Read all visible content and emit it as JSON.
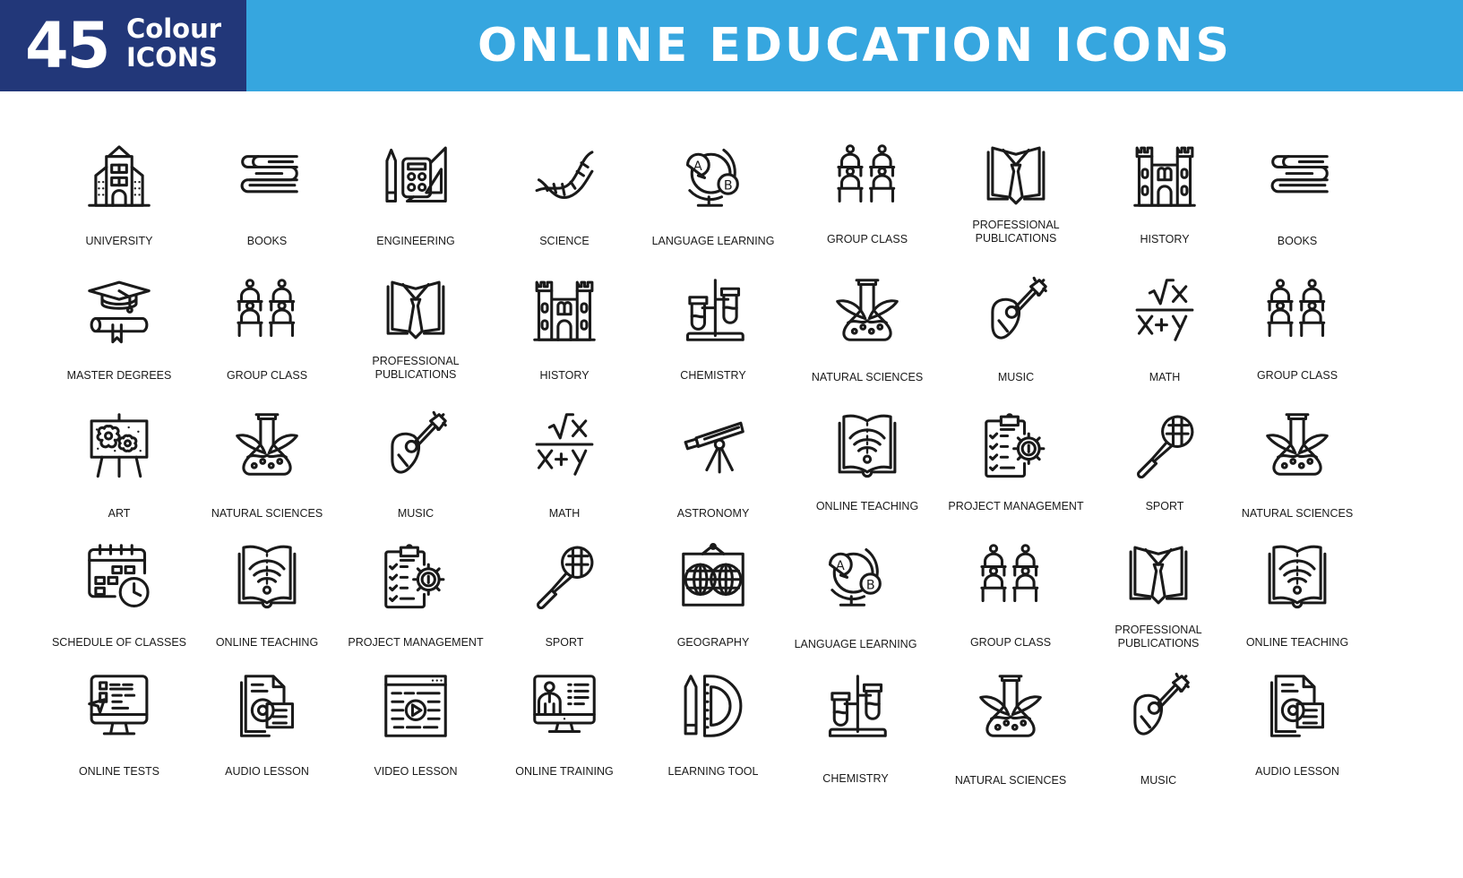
{
  "header": {
    "count": "45",
    "count_word1": "Colour",
    "count_word2": "ICONS",
    "title": "ONLINE EDUCATION ICONS",
    "colors": {
      "badge": "#223779",
      "banner": "#36a6df",
      "text": "#ffffff",
      "icon_stroke": "#1a1a1a"
    }
  },
  "rows": [
    [
      {
        "icon": "university-icon",
        "label": "UNIVERSITY"
      },
      {
        "icon": "books-icon",
        "label": "BOOKS"
      },
      {
        "icon": "engineering-icon",
        "label": "ENGINEERING"
      },
      {
        "icon": "dna-icon",
        "label": "SCIENCE"
      },
      {
        "icon": "language-globe-icon",
        "label": "LANGUAGE LEARNING"
      },
      {
        "icon": "group-class-icon",
        "label": "GROUP CLASS"
      },
      {
        "icon": "book-tie-icon",
        "label": "PROFESSIONAL PUBLICATIONS"
      },
      {
        "icon": "castle-icon",
        "label": "HISTORY"
      },
      {
        "icon": "books-icon",
        "label": "BOOKS"
      }
    ],
    [
      {
        "icon": "graduation-diploma-icon",
        "label": "MASTER DEGREES"
      },
      {
        "icon": "group-class-icon",
        "label": "GROUP CLASS"
      },
      {
        "icon": "book-tie-icon",
        "label": "PROFESSIONAL PUBLICATIONS"
      },
      {
        "icon": "castle-icon",
        "label": "HISTORY"
      },
      {
        "icon": "test-tubes-icon",
        "label": "CHEMISTRY"
      },
      {
        "icon": "flask-leaves-icon",
        "label": "NATURAL SCIENCES"
      },
      {
        "icon": "mandolin-icon",
        "label": "MUSIC"
      },
      {
        "icon": "math-formula-icon",
        "label": "MATH"
      },
      {
        "icon": "group-class-icon",
        "label": "GROUP CLASS"
      }
    ],
    [
      {
        "icon": "easel-painting-icon",
        "label": "ART"
      },
      {
        "icon": "flask-leaves-icon",
        "label": "NATURAL SCIENCES"
      },
      {
        "icon": "mandolin-icon",
        "label": "MUSIC"
      },
      {
        "icon": "math-formula-icon",
        "label": "MATH"
      },
      {
        "icon": "telescope-icon",
        "label": "ASTRONOMY"
      },
      {
        "icon": "book-wifi-icon",
        "label": "ONLINE TEACHING"
      },
      {
        "icon": "clipboard-gear-icon",
        "label": "PROJECT MANAGEMENT"
      },
      {
        "icon": "tennis-racket-icon",
        "label": "SPORT"
      },
      {
        "icon": "flask-leaves-icon",
        "label": "NATURAL SCIENCES"
      }
    ],
    [
      {
        "icon": "calendar-clock-icon",
        "label": "SCHEDULE OF CLASSES"
      },
      {
        "icon": "book-wifi-icon",
        "label": "ONLINE TEACHING"
      },
      {
        "icon": "clipboard-gear-icon",
        "label": "PROJECT MANAGEMENT"
      },
      {
        "icon": "tennis-racket-icon",
        "label": "SPORT"
      },
      {
        "icon": "world-map-icon",
        "label": "GEOGRAPHY"
      },
      {
        "icon": "language-globe-icon",
        "label": "LANGUAGE LEARNING"
      },
      {
        "icon": "group-class-icon",
        "label": "GROUP CLASS"
      },
      {
        "icon": "book-tie-icon",
        "label": "PROFESSIONAL PUBLICATIONS"
      },
      {
        "icon": "book-wifi-icon",
        "label": "ONLINE TEACHING"
      }
    ],
    [
      {
        "icon": "monitor-test-icon",
        "label": "ONLINE TESTS"
      },
      {
        "icon": "audio-document-icon",
        "label": "AUDIO LESSON"
      },
      {
        "icon": "video-player-icon",
        "label": "VIDEO LESSON"
      },
      {
        "icon": "monitor-presenter-icon",
        "label": "ONLINE TRAINING"
      },
      {
        "icon": "pencil-protractor-icon",
        "label": "LEARNING TOOL"
      },
      {
        "icon": "test-tubes-icon",
        "label": "CHEMISTRY"
      },
      {
        "icon": "flask-leaves-icon",
        "label": "NATURAL SCIENCES"
      },
      {
        "icon": "mandolin-icon",
        "label": "MUSIC"
      },
      {
        "icon": "audio-document-icon",
        "label": "AUDIO LESSON"
      }
    ]
  ]
}
